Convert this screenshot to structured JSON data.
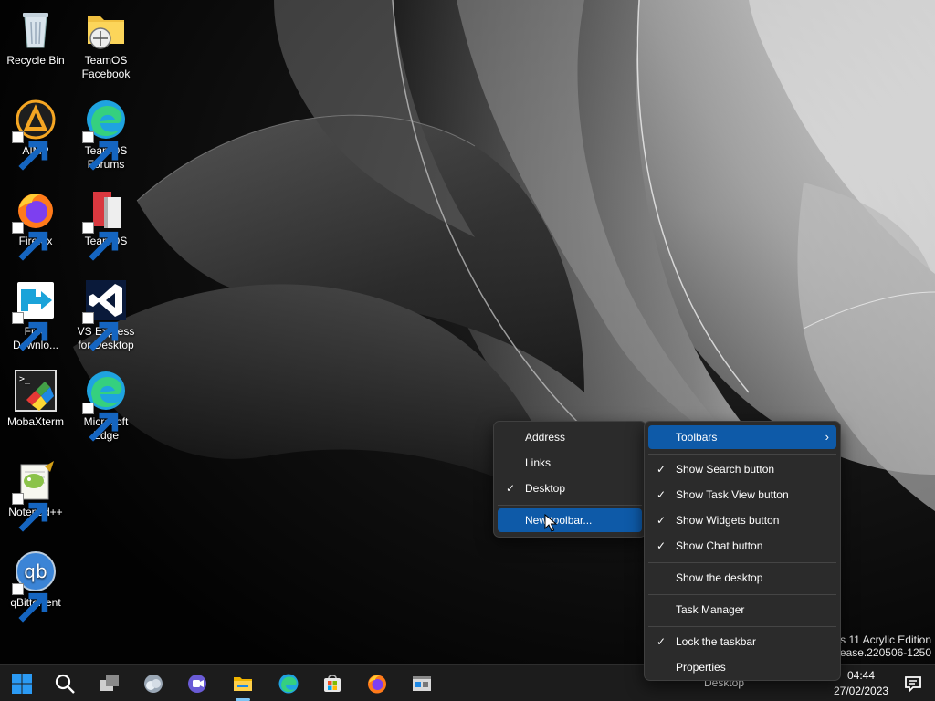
{
  "desktop": {
    "icons": [
      {
        "label": "Recycle Bin"
      },
      {
        "label": "TeamOS Facebook"
      },
      {
        "label": "AIMP"
      },
      {
        "label": "TeamOS Forums"
      },
      {
        "label": "Firefox"
      },
      {
        "label": "TeamOS"
      },
      {
        "label": "Free Downlo..."
      },
      {
        "label": "VS Express for Desktop"
      },
      {
        "label": "MobaXterm"
      },
      {
        "label": "Microsoft Edge"
      },
      {
        "label": "Notepad++"
      },
      {
        "label": "qBittorrent"
      }
    ],
    "watermark_line1": "s 11 Acrylic Edition",
    "watermark_line2": "elease.220506-1250"
  },
  "toolbars_submenu": {
    "items": [
      {
        "label": "Address",
        "checked": false
      },
      {
        "label": "Links",
        "checked": false
      },
      {
        "label": "Desktop",
        "checked": true
      },
      {
        "label": "New toolbar...",
        "checked": false,
        "highlighted": true
      }
    ]
  },
  "taskbar_menu": {
    "toolbars_label": "Toolbars",
    "items": [
      {
        "label": "Show Search button",
        "checked": true
      },
      {
        "label": "Show Task View button",
        "checked": true
      },
      {
        "label": "Show Widgets button",
        "checked": true
      },
      {
        "label": "Show Chat button",
        "checked": true
      },
      {
        "label": "Show the desktop",
        "checked": false
      },
      {
        "label": "Task Manager",
        "checked": false
      },
      {
        "label": "Lock the taskbar",
        "checked": true
      },
      {
        "label": "Properties",
        "checked": false
      }
    ],
    "check_glyph": "✓",
    "chevron_glyph": "›"
  },
  "taskbar": {
    "desktop_toolbar_label": "Desktop",
    "time": "04:44",
    "date": "27/02/2023",
    "pinned": [
      "start-icon",
      "search-icon",
      "task-view-icon",
      "widgets-icon",
      "chat-icon",
      "file-explorer-icon",
      "edge-icon",
      "store-icon",
      "firefox-icon",
      "control-panel-icon"
    ]
  },
  "colors": {
    "menu_bg": "#2b2b2b",
    "highlight": "#0e5aa8",
    "taskbar_bg": "#1c1c1c",
    "windows_blue": "#2b9af3"
  }
}
